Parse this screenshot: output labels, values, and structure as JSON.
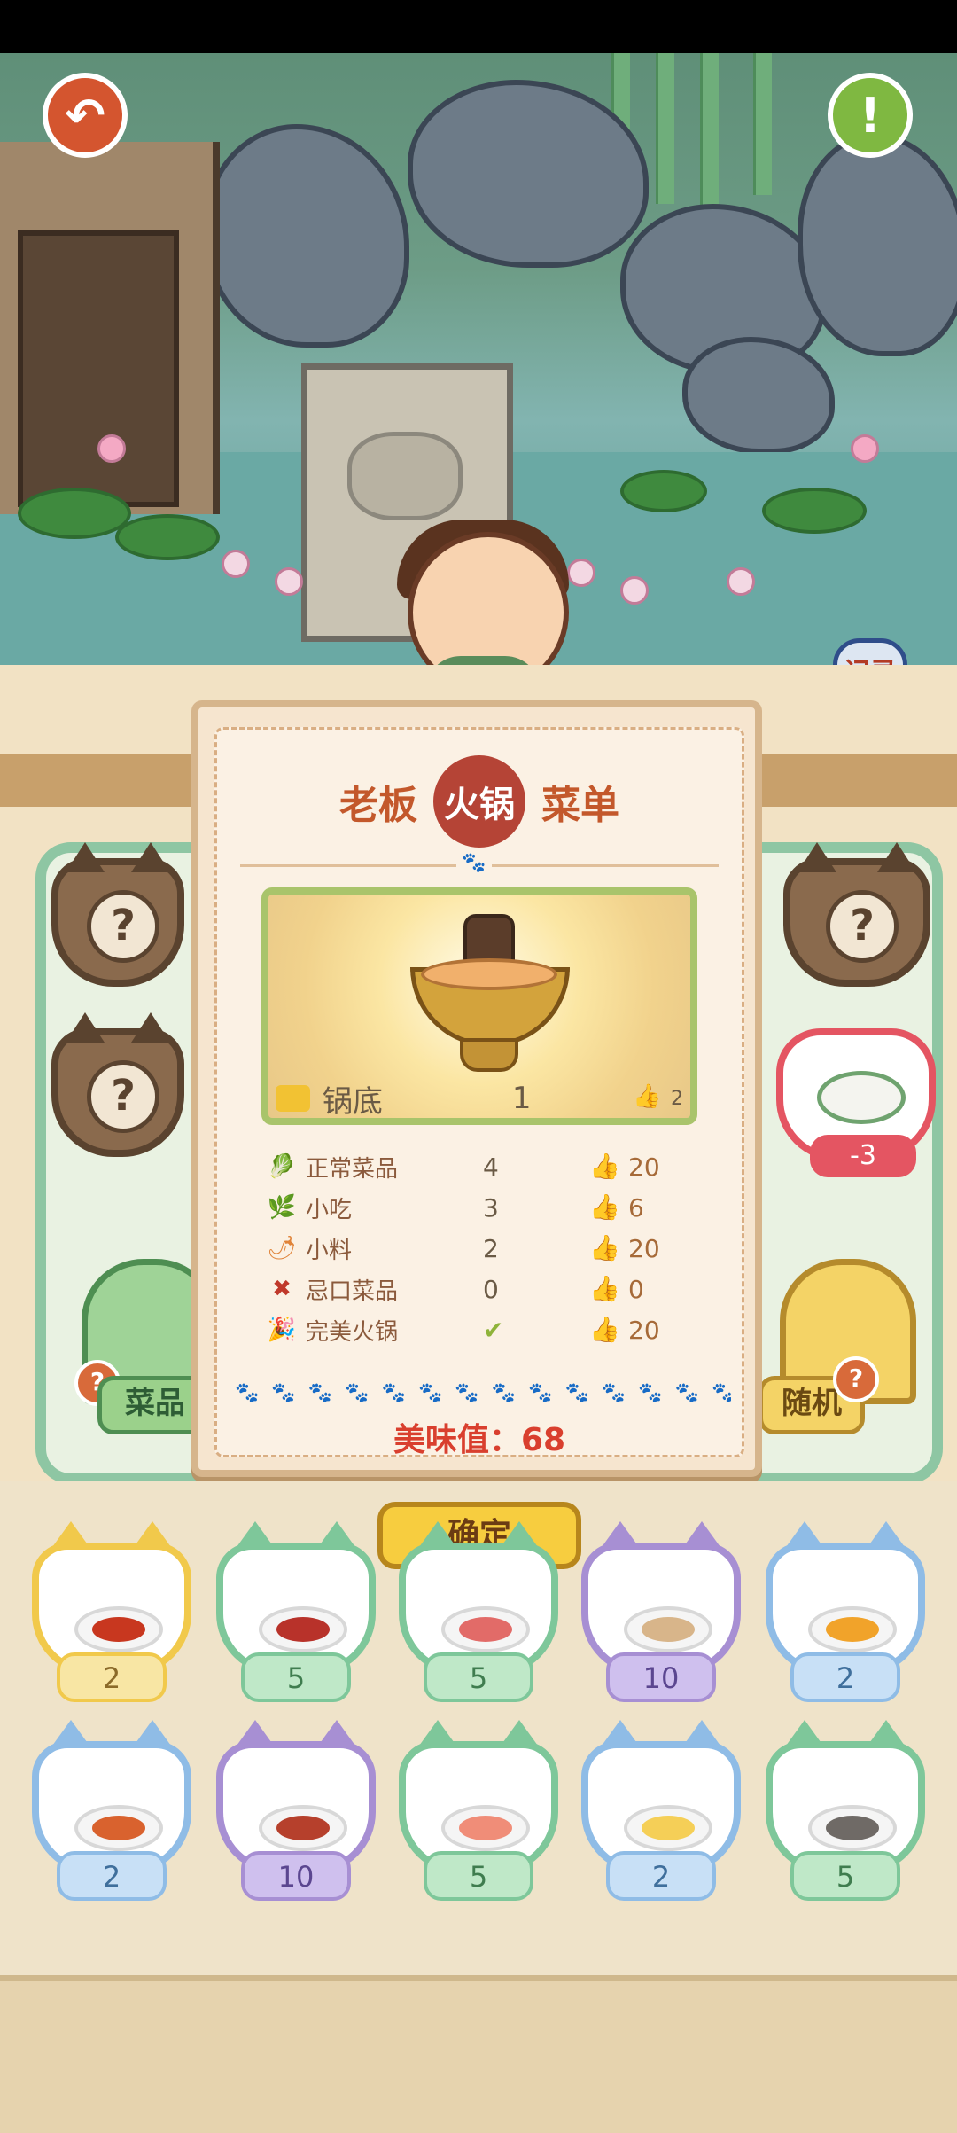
{
  "record_label": "记录",
  "dialog": {
    "title_left": "老板",
    "title_badge": "火锅",
    "title_right": "菜单",
    "pot_row": {
      "label": "锅底",
      "count": "1",
      "score": "2"
    },
    "stats": [
      {
        "icon": "vegetable-icon",
        "label": "正常菜品",
        "count": "4",
        "score": "20"
      },
      {
        "icon": "snack-icon",
        "label": "小吃",
        "count": "3",
        "score": "6"
      },
      {
        "icon": "seasoning-icon",
        "label": "小料",
        "count": "2",
        "score": "20"
      },
      {
        "icon": "forbidden-icon",
        "label": "忌口菜品",
        "count": "0",
        "score": "0"
      },
      {
        "icon": "party-icon",
        "label": "完美火锅",
        "count": "✔",
        "score": "20"
      }
    ],
    "tasty_label": "美味值：",
    "tasty_value": "68"
  },
  "confirm_label": "确定",
  "left_bell_label": "菜品",
  "right_bell_label": "随机",
  "question_mark": "?",
  "red_cat_value": "-3",
  "dish_row1": [
    {
      "count": "2",
      "theme": "yellow",
      "food_color": "#c8371f"
    },
    {
      "count": "5",
      "theme": "green",
      "food_color": "#b8322a"
    },
    {
      "count": "5",
      "theme": "green",
      "food_color": "#e26b68"
    },
    {
      "count": "10",
      "theme": "purple",
      "food_color": "#d8b58a"
    },
    {
      "count": "2",
      "theme": "blue",
      "food_color": "#f1a32a"
    }
  ],
  "dish_row2": [
    {
      "count": "2",
      "theme": "blue",
      "food_color": "#d9622e"
    },
    {
      "count": "10",
      "theme": "purple",
      "food_color": "#b6402c"
    },
    {
      "count": "5",
      "theme": "green",
      "food_color": "#f08d78"
    },
    {
      "count": "2",
      "theme": "blue",
      "food_color": "#f5cf57"
    },
    {
      "count": "5",
      "theme": "green",
      "food_color": "#6f6a66"
    }
  ],
  "themes": {
    "yellow": {
      "border": "#f1c94b",
      "ribbon_bg": "#f8e6a4",
      "text": "#8b6b2a"
    },
    "green": {
      "border": "#7ec79a",
      "ribbon_bg": "#bfe8c8",
      "text": "#3f7d4f"
    },
    "purple": {
      "border": "#a78fd3",
      "ribbon_bg": "#cfc0ee",
      "text": "#5b4690"
    },
    "blue": {
      "border": "#8fbce6",
      "ribbon_bg": "#c8e0f6",
      "text": "#3f6f9c"
    }
  }
}
